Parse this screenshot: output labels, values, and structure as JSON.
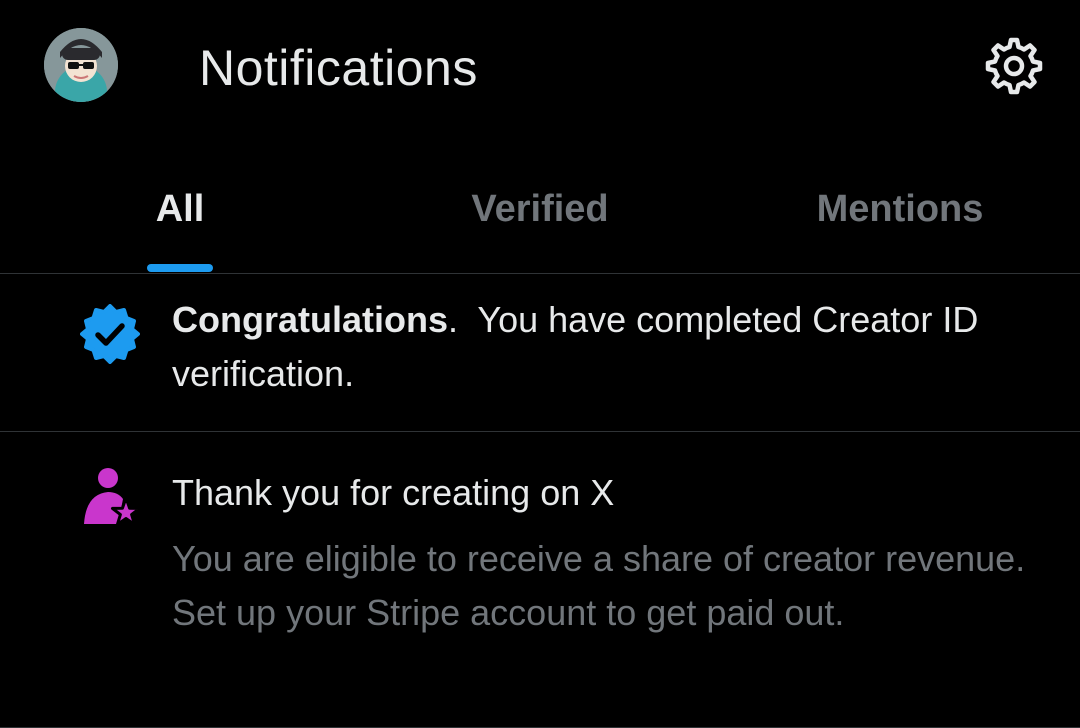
{
  "header": {
    "title": "Notifications",
    "avatar_icon": "user-avatar",
    "settings_icon": "gear-icon"
  },
  "tabs": [
    {
      "label": "All",
      "active": true
    },
    {
      "label": "Verified",
      "active": false
    },
    {
      "label": "Mentions",
      "active": false
    }
  ],
  "notifications": [
    {
      "icon": "verified-badge-icon",
      "bold": "Congratulations",
      "text": ".  You have completed Creator ID verification."
    },
    {
      "icon": "creator-star-icon",
      "title": "Thank you for creating on X",
      "body": "You are eligible to receive a share of creator revenue. Set up your Stripe account to get paid out."
    }
  ],
  "colors": {
    "background": "#000000",
    "text": "#e7e9ea",
    "muted": "#71767b",
    "accent": "#1d9bf0",
    "creator_purple": "#c936cc",
    "divider": "#2f3336"
  }
}
